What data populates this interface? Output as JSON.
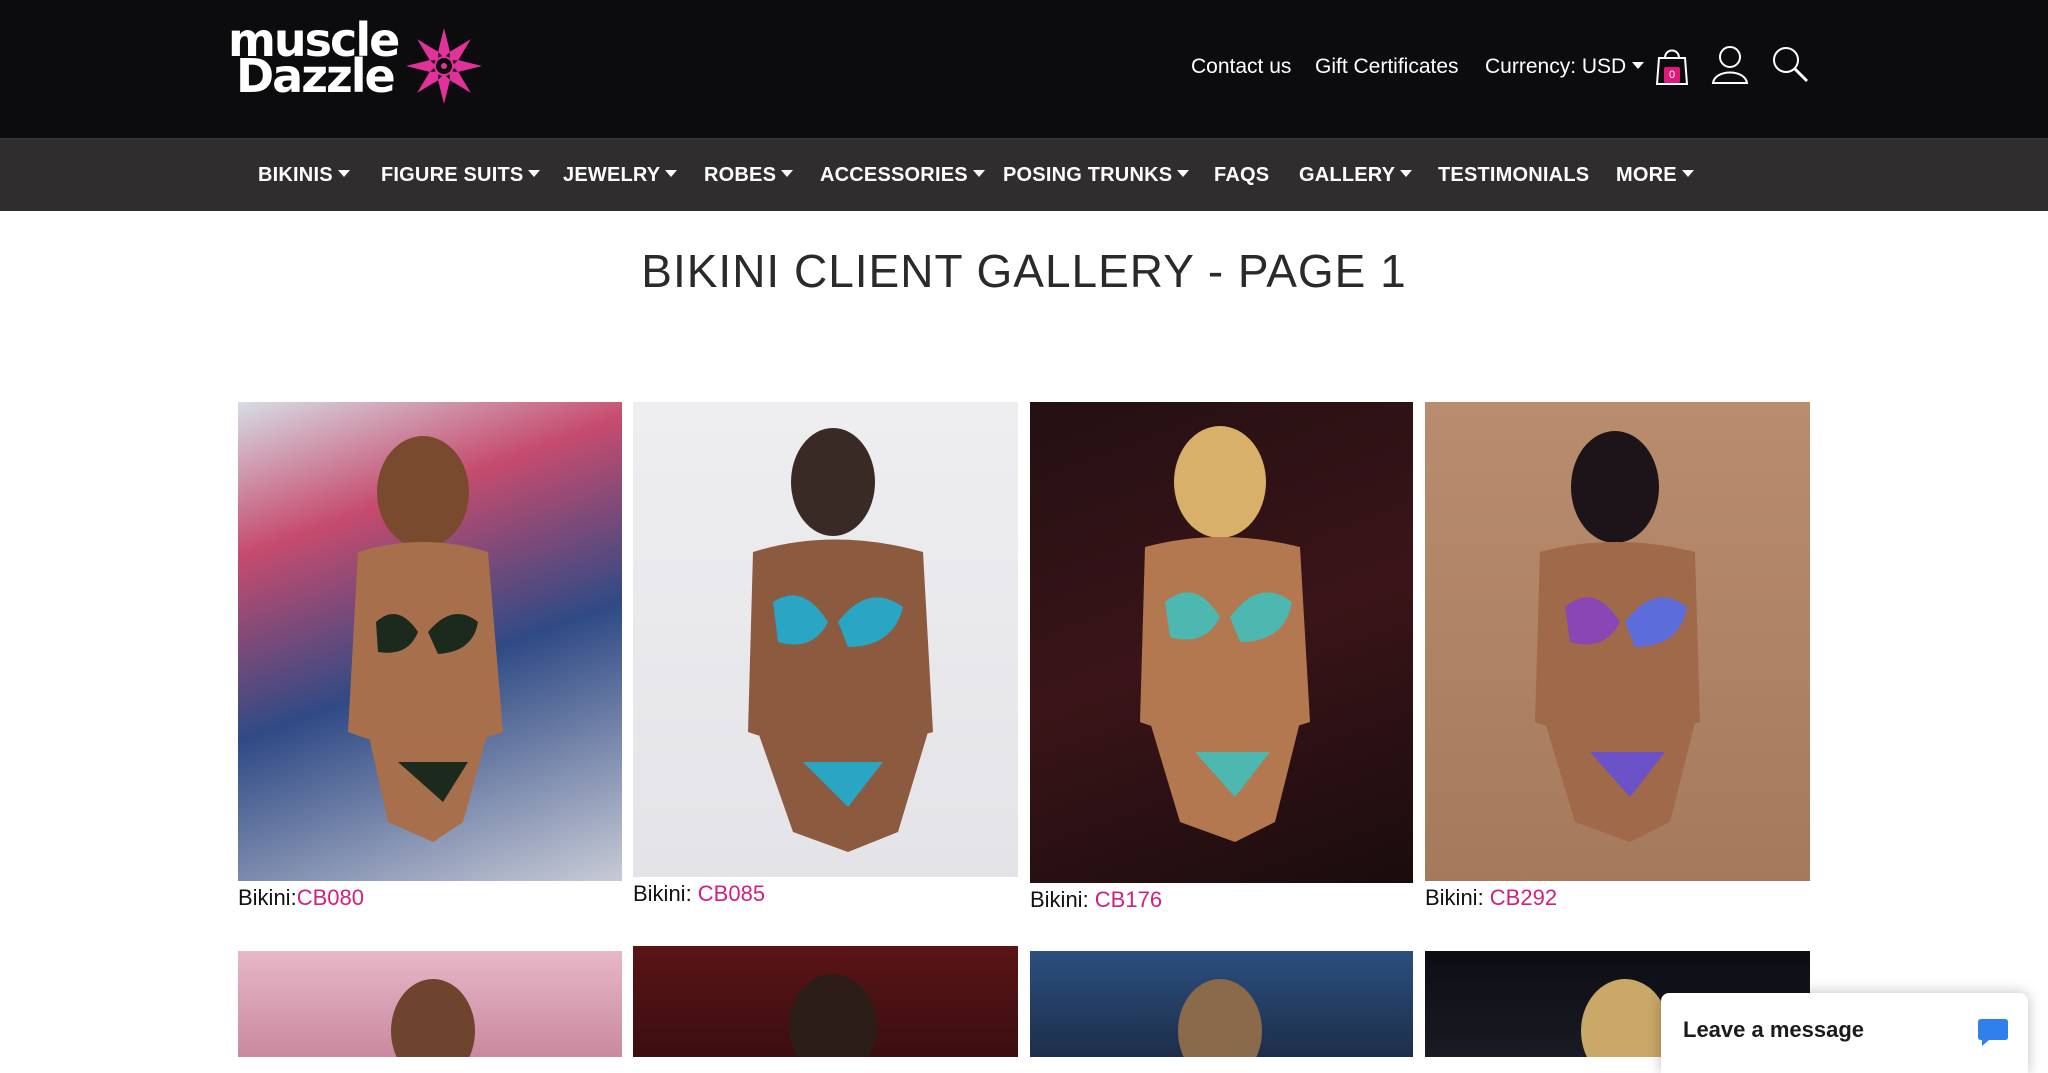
{
  "header": {
    "logo_text_1": "muscle",
    "logo_text_2": "Dazzle",
    "contact": "Contact us",
    "gift": "Gift Certificates",
    "currency": "Currency: USD",
    "cart_count": "0"
  },
  "nav": [
    {
      "label": "BIKINIS",
      "dropdown": true
    },
    {
      "label": "FIGURE SUITS",
      "dropdown": true
    },
    {
      "label": "JEWELRY",
      "dropdown": true
    },
    {
      "label": "ROBES",
      "dropdown": true
    },
    {
      "label": "ACCESSORIES",
      "dropdown": true
    },
    {
      "label": "POSING TRUNKS",
      "dropdown": true
    },
    {
      "label": "FAQS",
      "dropdown": false
    },
    {
      "label": "GALLERY",
      "dropdown": true
    },
    {
      "label": "TESTIMONIALS",
      "dropdown": false
    },
    {
      "label": "MORE",
      "dropdown": true
    }
  ],
  "page_title": "BIKINI CLIENT GALLERY - PAGE 1",
  "gallery": [
    {
      "prefix": "Bikini:",
      "code": "CB080"
    },
    {
      "prefix": "Bikini: ",
      "code": "CB085"
    },
    {
      "prefix": "Bikini: ",
      "code": "CB176"
    },
    {
      "prefix": "Bikini: ",
      "code": "CB292"
    }
  ],
  "chat": {
    "label": "Leave a message"
  },
  "colors": {
    "accent": "#d1207f",
    "topbar": "#0c0b0e",
    "navbar": "#2f2d2e"
  }
}
